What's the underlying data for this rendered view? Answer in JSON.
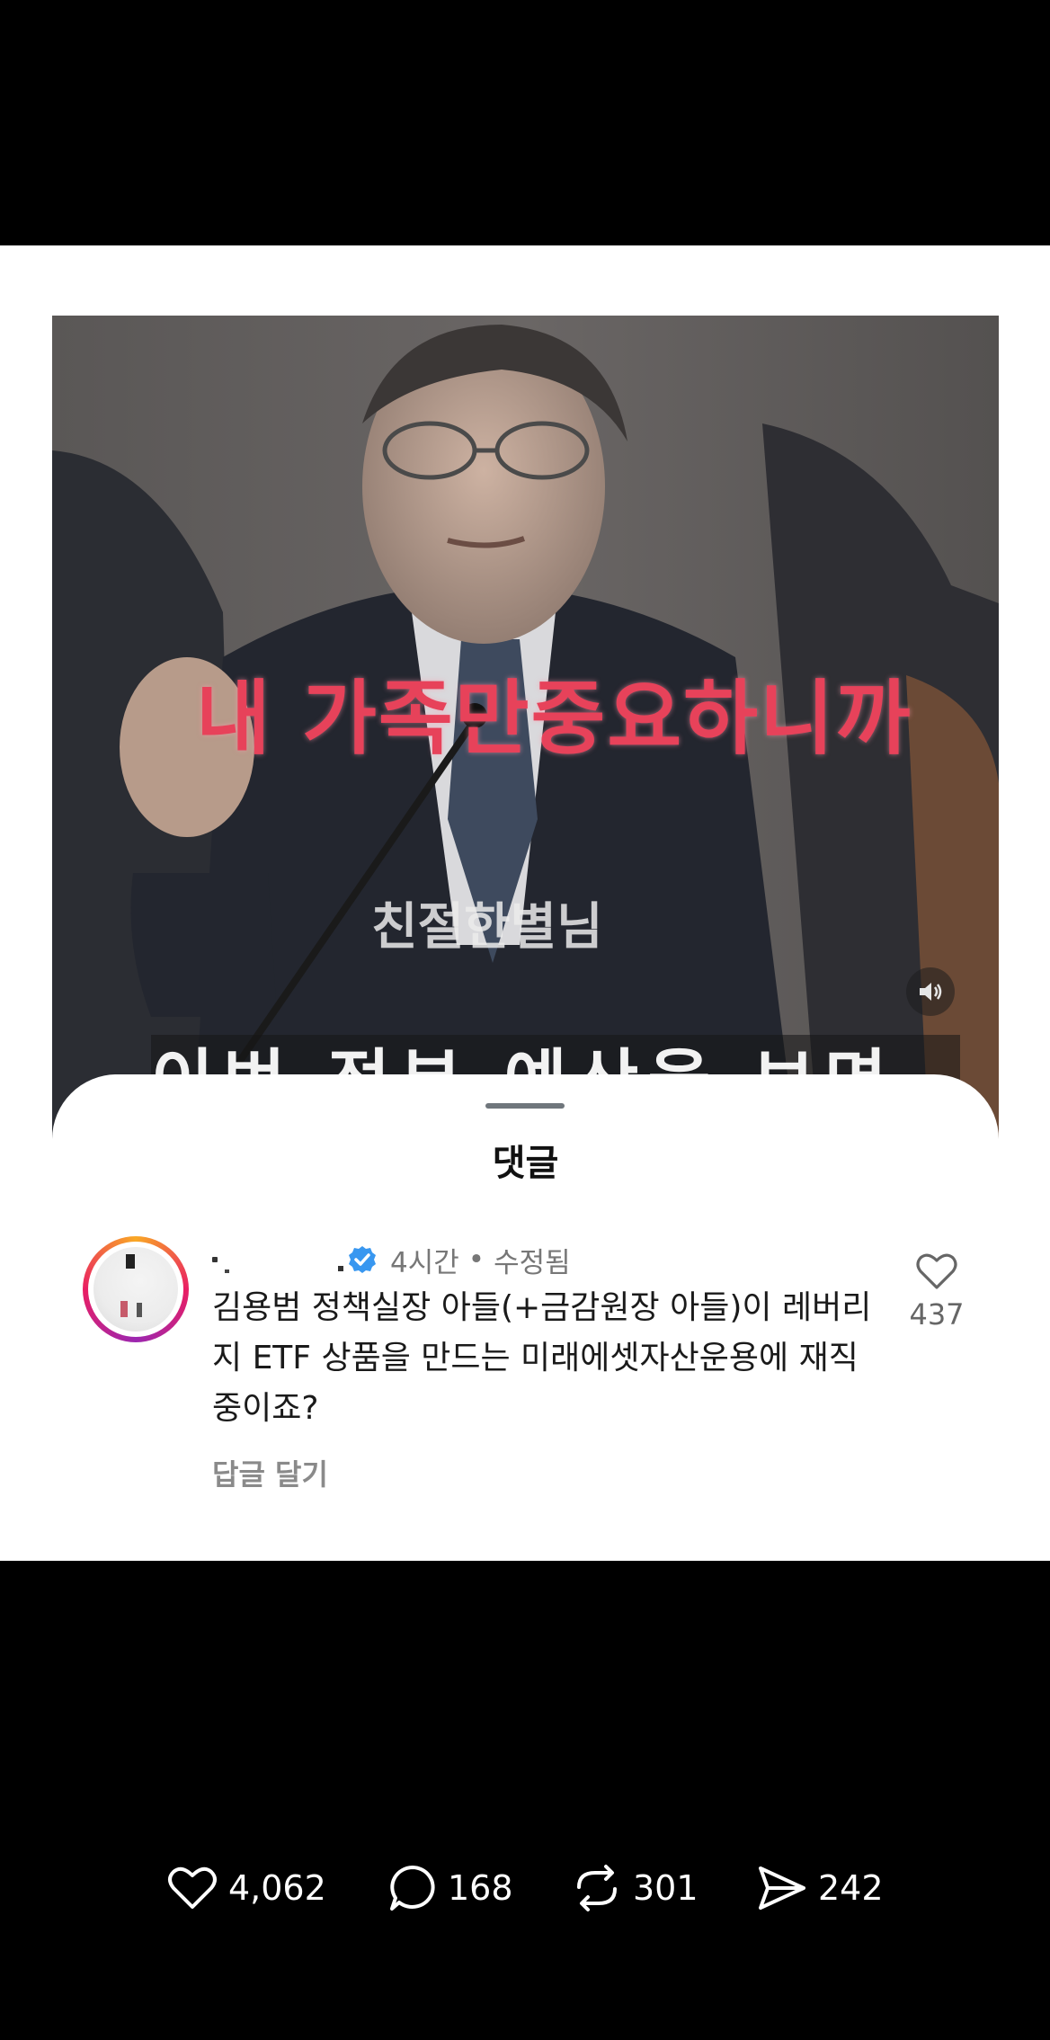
{
  "video": {
    "caption_main": "내 가족만중요하니까",
    "caption_watermark": "친절한별님",
    "caption_bottom": "이번 정부 예산을 보면",
    "sound_icon": "speaker-icon"
  },
  "comments_sheet": {
    "title": "댓글",
    "comment": {
      "time": "4시간",
      "separator": "•",
      "edited": "수정됨",
      "text": "김용범 정책실장 아들(+금감원장 아들)이 레버리지 ETF 상품을 만드는 미래에셋자산운용에 재직 중이죠?",
      "reply_label": "답글 달기",
      "like_count": "437"
    }
  },
  "actions": {
    "likes": "4,062",
    "comments": "168",
    "reposts": "301",
    "shares": "242"
  },
  "colors": {
    "caption_red": "#e7425a",
    "verified_blue": "#3897f0",
    "meta_gray": "#777777"
  }
}
